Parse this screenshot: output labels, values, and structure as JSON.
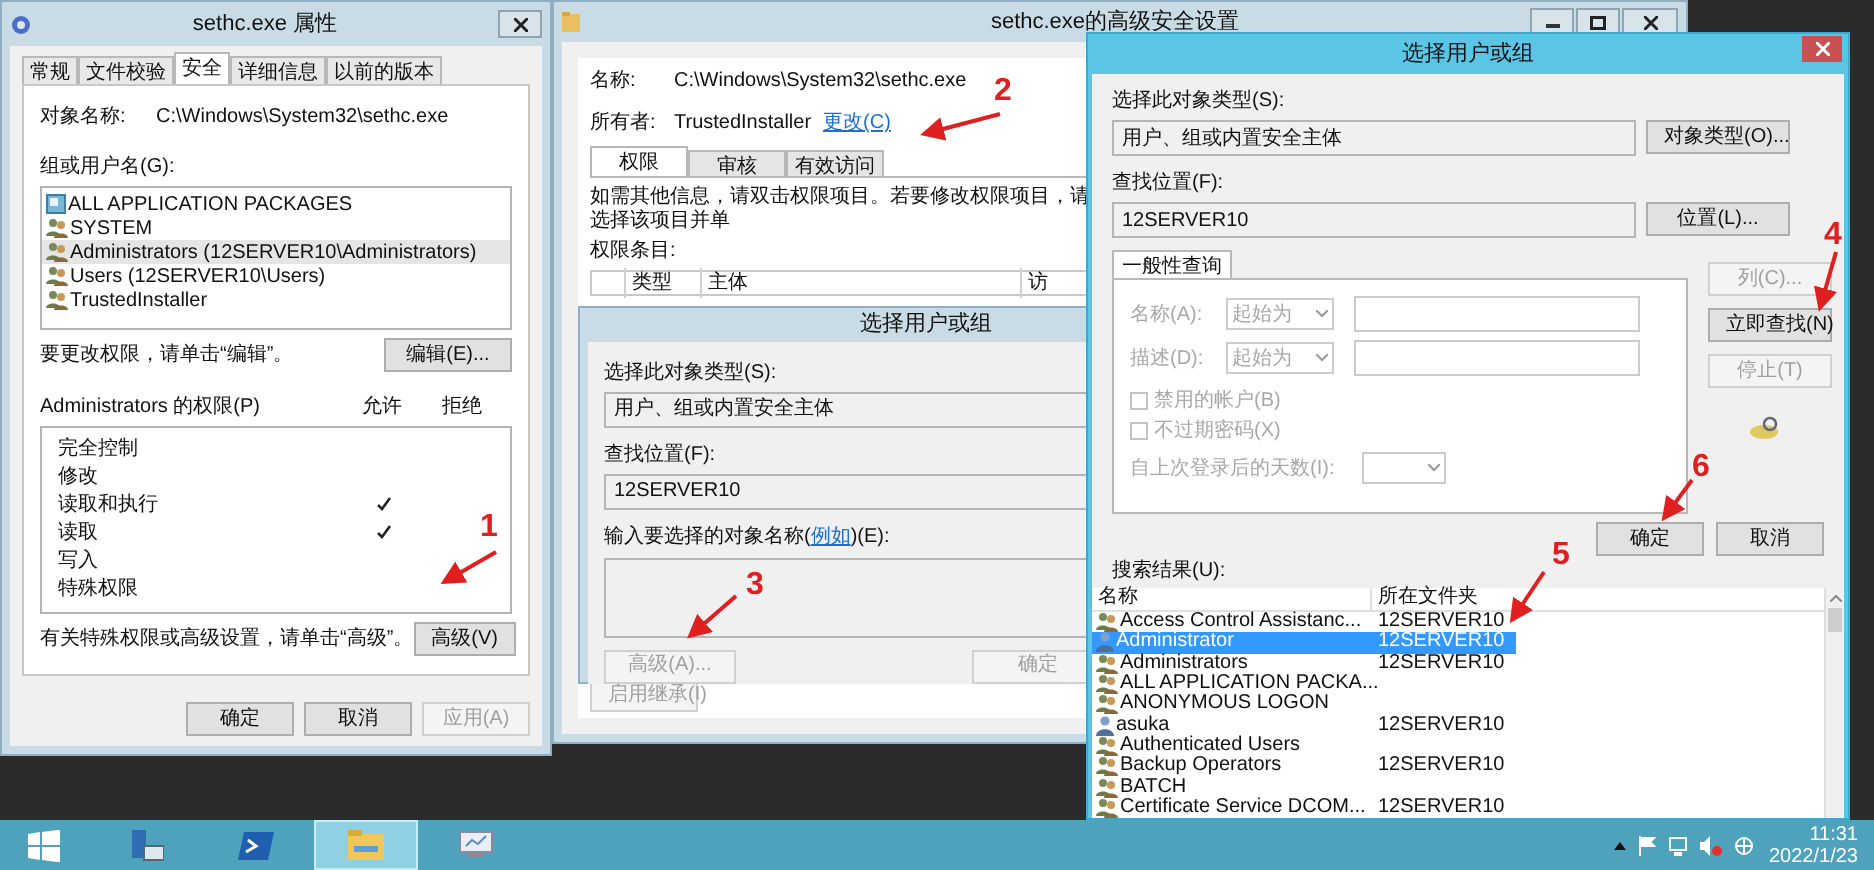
{
  "properties_window": {
    "title": "sethc.exe 属性",
    "tabs": [
      {
        "label": "常规",
        "selected": false
      },
      {
        "label": "文件校验",
        "selected": false
      },
      {
        "label": "安全",
        "selected": true
      },
      {
        "label": "详细信息",
        "selected": false
      },
      {
        "label": "以前的版本",
        "selected": false
      }
    ],
    "object_label": "对象名称:",
    "object_value": "C:\\Windows\\System32\\sethc.exe",
    "groups_label": "组或用户名(G):",
    "groups": [
      {
        "name": "ALL APPLICATION PACKAGES",
        "kind": "package",
        "selected": false
      },
      {
        "name": "SYSTEM",
        "kind": "group",
        "selected": false
      },
      {
        "name": "Administrators (12SERVER10\\Administrators)",
        "kind": "group",
        "selected": true
      },
      {
        "name": "Users (12SERVER10\\Users)",
        "kind": "group",
        "selected": false
      },
      {
        "name": "TrustedInstaller",
        "kind": "group",
        "selected": false
      }
    ],
    "edit_hint": "要更改权限，请单击“编辑”。",
    "edit_button": "编辑(E)...",
    "permissions_label": "Administrators 的权限(P)",
    "allow_header": "允许",
    "deny_header": "拒绝",
    "permissions": [
      {
        "name": "完全控制",
        "allow": false,
        "deny": false
      },
      {
        "name": "修改",
        "allow": false,
        "deny": false
      },
      {
        "name": "读取和执行",
        "allow": true,
        "deny": false
      },
      {
        "name": "读取",
        "allow": true,
        "deny": false
      },
      {
        "name": "写入",
        "allow": false,
        "deny": false
      },
      {
        "name": "特殊权限",
        "allow": false,
        "deny": false
      }
    ],
    "advanced_hint": "有关特殊权限或高级设置，请单击“高级”。",
    "advanced_button": "高级(V)",
    "buttons": [
      {
        "label": "确定",
        "disabled": false
      },
      {
        "label": "取消",
        "disabled": false
      },
      {
        "label": "应用(A)",
        "disabled": true
      }
    ]
  },
  "advanced_window": {
    "title": "sethc.exe的高级安全设置",
    "name_label": "名称:",
    "name_value": "C:\\Windows\\System32\\sethc.exe",
    "owner_label": "所有者:",
    "owner_value": "TrustedInstaller",
    "change_link": "更改(C)",
    "tabs": [
      {
        "label": "权限",
        "selected": true
      },
      {
        "label": "审核",
        "selected": false
      },
      {
        "label": "有效访问",
        "selected": false
      }
    ],
    "info_text": "如需其他信息，请双击权限项目。若要修改权限项目，请选择该项目并单",
    "entries_label": "权限条目:",
    "columns": [
      "类型",
      "主体",
      "访"
    ],
    "inheritance_button": "启用继承(I)"
  },
  "inner_dialog": {
    "title": "选择用户或组",
    "object_type_label": "选择此对象类型(S):",
    "object_type_value": "用户、组或内置安全主体",
    "location_label": "查找位置(F):",
    "location_value": "12SERVER10",
    "names_label": "输入要选择的对象名称(",
    "example_link": "例如",
    "names_label_end": ")(E):",
    "buttons": [
      {
        "label": "高级(A)...",
        "disabled": true
      },
      {
        "label": "确定",
        "disabled": true
      }
    ]
  },
  "select_dialog": {
    "title": "选择用户或组",
    "object_type_label": "选择此对象类型(S):",
    "object_type_value": "用户、组或内置安全主体",
    "object_types_button": "对象类型(O)...",
    "location_label": "查找位置(F):",
    "location_value": "12SERVER10",
    "location_button": "位置(L)...",
    "query_tab": "一般性查询",
    "name_label": "名称(A):",
    "name_mode": "起始为",
    "description_label": "描述(D):",
    "description_mode": "起始为",
    "checkboxes": [
      {
        "label": "禁用的帐户(B)",
        "checked": false
      },
      {
        "label": "不过期密码(X)",
        "checked": false
      }
    ],
    "days_label": "自上次登录后的天数(I):",
    "side_buttons": [
      {
        "label": "列(C)...",
        "disabled": true
      },
      {
        "label": "立即查找(N)",
        "disabled": false
      },
      {
        "label": "停止(T)",
        "disabled": true
      }
    ],
    "ok_button": "确定",
    "cancel_button": "取消",
    "results_label": "搜索结果(U):",
    "columns": [
      "名称",
      "所在文件夹"
    ],
    "results": [
      {
        "name": "Access Control Assistanc...",
        "folder": "12SERVER10",
        "kind": "group",
        "selected": false
      },
      {
        "name": "Administrator",
        "folder": "12SERVER10",
        "kind": "user",
        "selected": true
      },
      {
        "name": "Administrators",
        "folder": "12SERVER10",
        "kind": "group",
        "selected": false
      },
      {
        "name": "ALL APPLICATION PACKA...",
        "kind": "group",
        "selected": false
      },
      {
        "name": "ANONYMOUS LOGON",
        "kind": "group",
        "selected": false
      },
      {
        "name": "asuka",
        "folder": "12SERVER10",
        "kind": "user",
        "selected": false
      },
      {
        "name": "Authenticated Users",
        "kind": "group",
        "selected": false
      },
      {
        "name": "Backup Operators",
        "folder": "12SERVER10",
        "kind": "group",
        "selected": false
      },
      {
        "name": "BATCH",
        "kind": "group",
        "selected": false
      },
      {
        "name": "Certificate Service DCOM...",
        "folder": "12SERVER10",
        "kind": "group",
        "selected": false
      }
    ]
  },
  "annotations": [
    {
      "number": "1"
    },
    {
      "number": "2"
    },
    {
      "number": "3"
    },
    {
      "number": "4"
    },
    {
      "number": "5"
    },
    {
      "number": "6"
    }
  ],
  "taskbar": {
    "apps": [
      {
        "kind": "start",
        "selected": false
      },
      {
        "kind": "server",
        "selected": false
      },
      {
        "kind": "powershell",
        "selected": false
      },
      {
        "kind": "explorer",
        "selected": true
      },
      {
        "kind": "monitor",
        "selected": false
      }
    ],
    "time": "11:31",
    "date": "2022/1/23"
  }
}
